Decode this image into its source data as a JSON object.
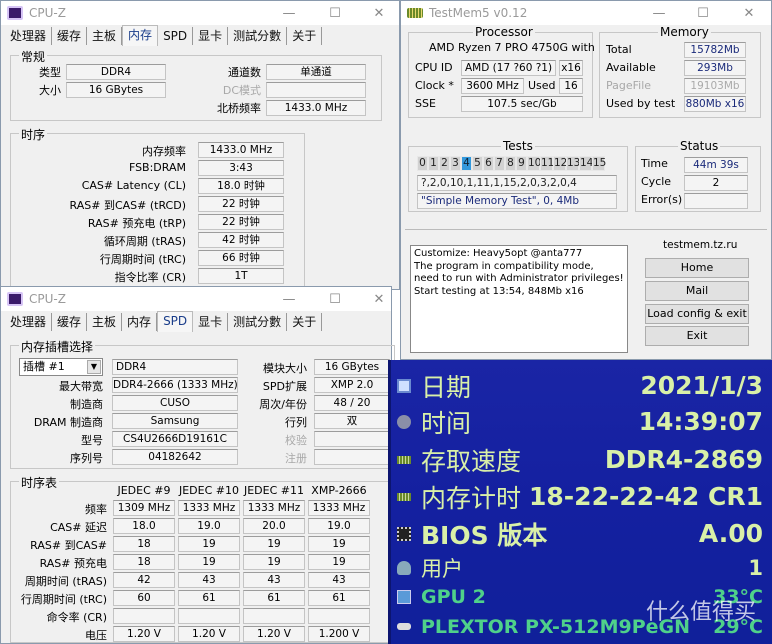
{
  "cpuz_memory": {
    "title": "CPU-Z",
    "tabs": [
      "处理器",
      "缓存",
      "主板",
      "内存",
      "SPD",
      "显卡",
      "测試分數",
      "关于"
    ],
    "active_tab": "内存",
    "general": {
      "label": "常规",
      "type_label": "类型",
      "type_value": "DDR4",
      "size_label": "大小",
      "size_value": "16 GBytes",
      "channels_label": "通道数",
      "channels_value": "单通道",
      "dc_label": "DC模式",
      "dc_value": "",
      "nb_label": "北桥频率",
      "nb_value": "1433.0 MHz"
    },
    "timings": {
      "label": "时序",
      "rows": [
        {
          "label": "内存频率",
          "value": "1433.0 MHz"
        },
        {
          "label": "FSB:DRAM",
          "value": "3:43"
        },
        {
          "label": "CAS# Latency (CL)",
          "value": "18.0 时钟"
        },
        {
          "label": "RAS# 到CAS# (tRCD)",
          "value": "22 时钟"
        },
        {
          "label": "RAS# 预充电 (tRP)",
          "value": "22 时钟"
        },
        {
          "label": "循环周期 (tRAS)",
          "value": "42 时钟"
        },
        {
          "label": "行周期时间 (tRC)",
          "value": "66 时钟"
        },
        {
          "label": "指令比率 (CR)",
          "value": "1T"
        }
      ]
    }
  },
  "cpuz_spd": {
    "title": "CPU-Z",
    "tabs": [
      "处理器",
      "缓存",
      "主板",
      "内存",
      "SPD",
      "显卡",
      "测試分數",
      "关于"
    ],
    "active_tab": "SPD",
    "slot_group_label": "内存插槽选择",
    "slot_select": "插槽 #1",
    "slot_type": "DDR4",
    "left_rows": [
      {
        "label": "最大带宽",
        "value": "DDR4-2666 (1333 MHz)"
      },
      {
        "label": "制造商",
        "value": "CUSO"
      },
      {
        "label": "DRAM 制造商",
        "value": "Samsung"
      },
      {
        "label": "型号",
        "value": "CS4U2666D19161C"
      },
      {
        "label": "序列号",
        "value": "04182642"
      }
    ],
    "right_rows": [
      {
        "label": "模块大小",
        "value": "16 GBytes",
        "disabled": false
      },
      {
        "label": "SPD扩展",
        "value": "XMP 2.0",
        "disabled": false
      },
      {
        "label": "周次/年份",
        "value": "48 / 20",
        "disabled": false
      },
      {
        "label": "行列",
        "value": "双",
        "disabled": false
      },
      {
        "label": "校验",
        "value": "",
        "disabled": true
      },
      {
        "label": "注册",
        "value": "",
        "disabled": true
      }
    ],
    "timing_table": {
      "label": "时序表",
      "columns": [
        "JEDEC #9",
        "JEDEC #10",
        "JEDEC #11",
        "XMP-2666"
      ],
      "rows": [
        {
          "label": "频率",
          "values": [
            "1309 MHz",
            "1333 MHz",
            "1333 MHz",
            "1333 MHz"
          ]
        },
        {
          "label": "CAS# 延迟",
          "values": [
            "18.0",
            "19.0",
            "20.0",
            "19.0"
          ]
        },
        {
          "label": "RAS# 到CAS#",
          "values": [
            "18",
            "19",
            "19",
            "19"
          ]
        },
        {
          "label": "RAS# 预充电",
          "values": [
            "18",
            "19",
            "19",
            "19"
          ]
        },
        {
          "label": "周期时间 (tRAS)",
          "values": [
            "42",
            "43",
            "43",
            "43"
          ]
        },
        {
          "label": "行周期时间 (tRC)",
          "values": [
            "60",
            "61",
            "61",
            "61"
          ]
        },
        {
          "label": "命令率 (CR)",
          "values": [
            "",
            "",
            "",
            ""
          ]
        },
        {
          "label": "电压",
          "values": [
            "1.20 V",
            "1.20 V",
            "1.20 V",
            "1.200 V"
          ]
        }
      ]
    }
  },
  "testmem": {
    "title": "TestMem5 v0.12",
    "processor": {
      "label": "Processor",
      "name": "AMD Ryzen 7 PRO 4750G with",
      "cpuid_label": "CPU ID",
      "cpuid_value": "AMD  (17 ?60 ?1)",
      "threads": "x16",
      "clock_label": "Clock *",
      "clock_value": "3600 MHz",
      "used_label": "Used",
      "used_value": "16",
      "sse_label": "SSE",
      "sse_value": "107.5 sec/Gb"
    },
    "memory": {
      "label": "Memory",
      "rows": [
        {
          "label": "Total",
          "value": "15782Mb",
          "disabled": false
        },
        {
          "label": "Available",
          "value": "293Mb",
          "disabled": false
        },
        {
          "label": "PageFile",
          "value": "19103Mb",
          "disabled": true
        },
        {
          "label": "Used by test",
          "value": "880Mb x16",
          "disabled": false
        }
      ]
    },
    "tests": {
      "label": "Tests",
      "numbers": [
        "0",
        "1",
        "2",
        "3",
        "4",
        "5",
        "6",
        "7",
        "8",
        "9",
        "10",
        "11",
        "12",
        "13",
        "14",
        "15"
      ],
      "current": "4",
      "sequence": "?,2,0,10,1,11,1,15,2,0,3,2,0,4",
      "current_test": "\"Simple Memory Test\", 0, 4Mb"
    },
    "status": {
      "label": "Status",
      "time_label": "Time",
      "time_value": "44m 39s",
      "cycle_label": "Cycle",
      "cycle_value": "2",
      "errors_label": "Error(s)",
      "errors_value": ""
    },
    "log": [
      "Customize: Heavy5opt @anta777",
      "The program in compatibility mode,",
      "need to run with Administrator privileges!",
      "Start testing at 13:54, 848Mb x16"
    ],
    "site": {
      "label": "testmem.tz.ru",
      "buttons": [
        "Home",
        "Mail",
        "Load config & exit",
        "Exit"
      ]
    }
  },
  "sidebar": {
    "rows": [
      {
        "icon": "calendar-icon",
        "label": "日期",
        "value": "2021/1/3"
      },
      {
        "icon": "clock-icon",
        "label": "时间",
        "value": "14:39:07"
      },
      {
        "icon": "memory-icon",
        "label": "存取速度",
        "value": "DDR4-2869"
      },
      {
        "icon": "memory-icon",
        "label": "内存计时",
        "value": "18-22-22-42 CR1"
      },
      {
        "icon": "chip-icon",
        "label": "BIOS 版本",
        "value": "A.00"
      },
      {
        "icon": "user-icon",
        "label": "用户",
        "value": "1"
      },
      {
        "icon": "monitor-icon",
        "label": "GPU 2",
        "value": "33°C"
      },
      {
        "icon": "drive-icon",
        "label": "PLEXTOR PX-512M9PeGN",
        "value": "29°C"
      }
    ],
    "colors": {
      "bg": "#1a25a5",
      "primary_text": "#d9f0a8",
      "sensor_text": "#4fd18a"
    }
  },
  "watermark": "什么值得买"
}
